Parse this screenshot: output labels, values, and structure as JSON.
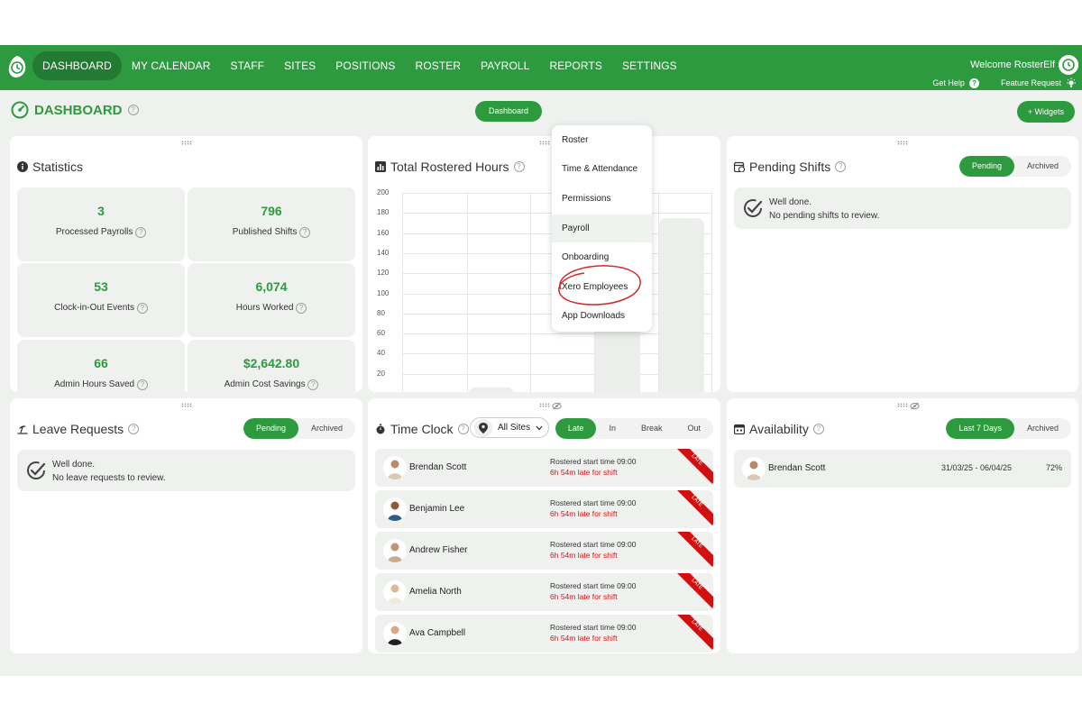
{
  "nav": {
    "items": [
      "DASHBOARD",
      "MY CALENDAR",
      "STAFF",
      "SITES",
      "POSITIONS",
      "ROSTER",
      "PAYROLL",
      "REPORTS",
      "SETTINGS"
    ],
    "welcome": "Welcome RosterElf",
    "get_help": "Get Help",
    "feature_request": "Feature Request"
  },
  "header": {
    "title": "DASHBOARD",
    "tab_dashboard": "Dashboard",
    "widgets_button": "+ Widgets"
  },
  "settings_menu": {
    "items": [
      "Roster",
      "Time & Attendance",
      "Permissions",
      "Payroll",
      "Onboarding",
      "Xero Employees",
      "App Downloads"
    ]
  },
  "statistics": {
    "title": "Statistics",
    "items": [
      {
        "value": "3",
        "label": "Processed Payrolls"
      },
      {
        "value": "796",
        "label": "Published Shifts"
      },
      {
        "value": "53",
        "label": "Clock-in-Out Events"
      },
      {
        "value": "6,074",
        "label": "Hours Worked"
      },
      {
        "value": "66",
        "label": "Admin Hours Saved"
      },
      {
        "value": "$2,642.80",
        "label": "Admin Cost Savings"
      }
    ]
  },
  "rostered_hours": {
    "title": "Total Rostered Hours"
  },
  "chart_data": {
    "type": "bar",
    "title": "Total Rostered Hours",
    "yticks": [
      "200",
      "180",
      "160",
      "140",
      "120",
      "100",
      "80",
      "60",
      "40",
      "20"
    ],
    "ylim": [
      0,
      200
    ],
    "values": [
      2,
      6,
      0,
      120,
      175
    ],
    "grid": true
  },
  "pending_shifts": {
    "title": "Pending Shifts",
    "tab_pending": "Pending",
    "tab_archived": "Archived",
    "empty_line1": "Well done.",
    "empty_line2": "No pending shifts to review."
  },
  "leave_requests": {
    "title": "Leave Requests",
    "tab_pending": "Pending",
    "tab_archived": "Archived",
    "empty_line1": "Well done.",
    "empty_line2": "No leave requests to review."
  },
  "time_clock": {
    "title": "Time Clock",
    "sites_value": "All Sites",
    "tabs": [
      "Late",
      "In",
      "Break",
      "Out"
    ],
    "ribbon": "LATE",
    "rows": [
      {
        "name": "Brendan Scott",
        "rostered": "Rostered start time 09:00",
        "late": "6h 54m late for shift"
      },
      {
        "name": "Benjamin Lee",
        "rostered": "Rostered start time 09:00",
        "late": "6h 54m late for shift"
      },
      {
        "name": "Andrew Fisher",
        "rostered": "Rostered start time 09:00",
        "late": "6h 54m late for shift"
      },
      {
        "name": "Amelia North",
        "rostered": "Rostered start time 09:00",
        "late": "6h 54m late for shift"
      },
      {
        "name": "Ava Campbell",
        "rostered": "Rostered start time 09:00",
        "late": "6h 54m late for shift"
      }
    ]
  },
  "availability": {
    "title": "Availability",
    "tab_last7": "Last 7 Days",
    "tab_archived": "Archived",
    "rows": [
      {
        "name": "Brendan Scott",
        "dates": "31/03/25 - 06/04/25",
        "percent": "72%"
      }
    ]
  },
  "colors": {
    "brand_green": "#2e9a3f",
    "late_red": "#d11111",
    "annotation_red": "#d42a2a"
  }
}
